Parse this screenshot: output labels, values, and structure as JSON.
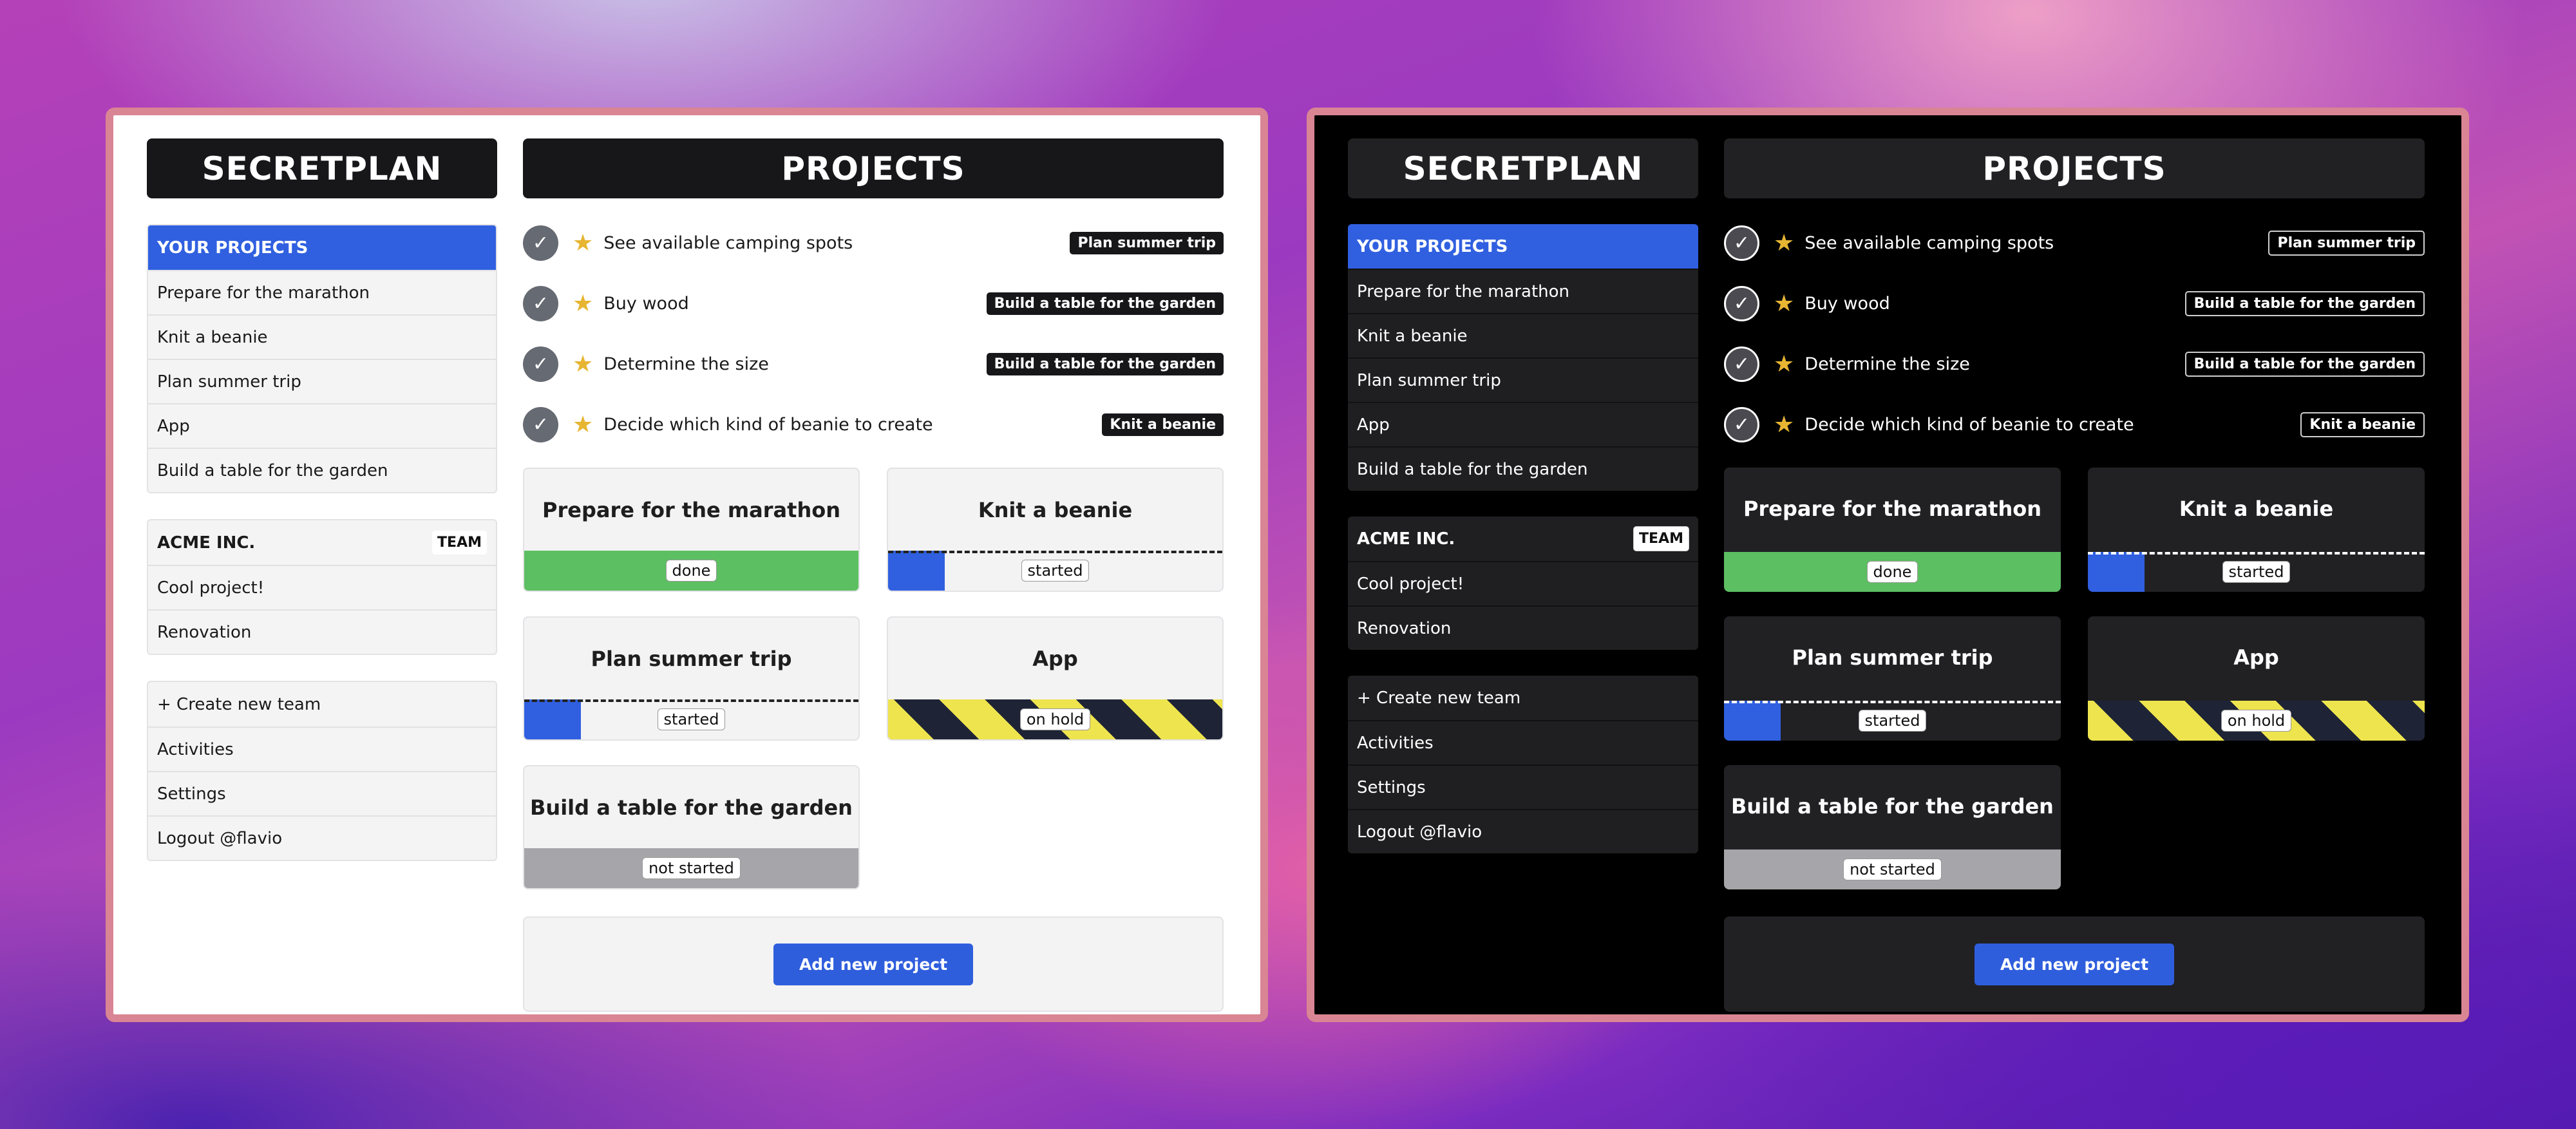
{
  "app": {
    "logo": "SECRETPLAN",
    "page_title": "PROJECTS"
  },
  "sidebar": {
    "projects_group": {
      "header": "YOUR PROJECTS",
      "items": [
        {
          "label": "Prepare for the marathon"
        },
        {
          "label": "Knit a beanie"
        },
        {
          "label": "Plan summer trip"
        },
        {
          "label": "App"
        },
        {
          "label": "Build a table for the garden"
        }
      ]
    },
    "team_group": {
      "name": "ACME INC.",
      "badge": "TEAM",
      "items": [
        {
          "label": "Cool project!"
        },
        {
          "label": "Renovation"
        }
      ]
    },
    "actions": [
      {
        "label": "+ Create new team"
      },
      {
        "label": "Activities"
      },
      {
        "label": "Settings"
      },
      {
        "label": "Logout @flavio"
      }
    ]
  },
  "tasks": [
    {
      "label": "See available camping spots",
      "project": "Plan summer trip"
    },
    {
      "label": "Buy wood",
      "project": "Build a table for the garden"
    },
    {
      "label": "Determine the size",
      "project": "Build a table for the garden"
    },
    {
      "label": "Decide which kind of beanie to create",
      "project": "Knit a beanie"
    }
  ],
  "projects": [
    {
      "title": "Prepare for the marathon",
      "status": "done"
    },
    {
      "title": "Knit a beanie",
      "status": "started"
    },
    {
      "title": "Plan summer trip",
      "status": "started"
    },
    {
      "title": "App",
      "status": "on hold"
    },
    {
      "title": "Build a table for the garden",
      "status": "not started"
    }
  ],
  "add_project_label": "Add new project",
  "icons": {
    "check": "checkmark-icon",
    "star": "star-icon"
  },
  "colors": {
    "accent": "#3060e0",
    "done": "#5cbf61",
    "not_started": "#a6a6aa",
    "hold_yellow": "#eee44e",
    "hold_dark": "#1e2436",
    "star": "#e7b532",
    "window_border": "#d98593"
  }
}
